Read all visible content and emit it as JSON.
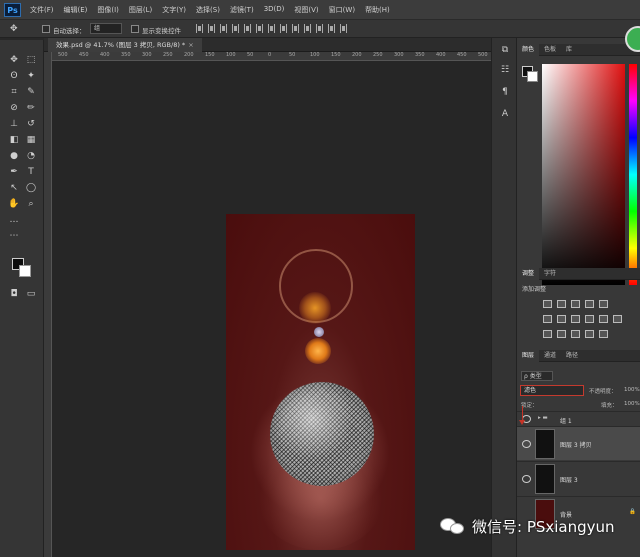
{
  "app": {
    "logo": "Ps"
  },
  "menu": [
    "文件(F)",
    "编辑(E)",
    "图像(I)",
    "图层(L)",
    "文字(Y)",
    "选择(S)",
    "滤镜(T)",
    "3D(D)",
    "视图(V)",
    "窗口(W)",
    "帮助(H)"
  ],
  "options": {
    "auto_select_label": "自动选择：",
    "auto_select_value": "组",
    "transform_label": "显示变换控件"
  },
  "document": {
    "tab_title": "效果.psd @ 41.7% (图层 3 拷贝, RGB/8) *",
    "ruler_ticks": [
      "500",
      "450",
      "400",
      "350",
      "300",
      "250",
      "200",
      "150",
      "100",
      "50",
      "0",
      "50",
      "100",
      "150",
      "200",
      "250",
      "300",
      "350",
      "400",
      "450",
      "500"
    ]
  },
  "color_panel": {
    "tabs": [
      "颜色",
      "色板",
      "库"
    ],
    "fg_color": "#111111",
    "bg_color": "#ffffff"
  },
  "adjust_panel": {
    "tabs": [
      "调整",
      "字符"
    ],
    "title": "添加调整"
  },
  "layers_panel": {
    "tabs": [
      "图层",
      "通道",
      "路径"
    ],
    "filter_kind": "ρ 类型",
    "blend_mode": "滤色",
    "opacity_label": "不透明度：",
    "opacity_value": "100%",
    "lock_label": "锁定：",
    "fill_label": "填充：",
    "fill_value": "100%",
    "layers": [
      {
        "name": "组 1",
        "type": "group"
      },
      {
        "name": "图层 3 拷贝",
        "type": "layer"
      },
      {
        "name": "图层 3",
        "type": "layer"
      },
      {
        "name": "背景",
        "type": "background"
      }
    ]
  },
  "watermark": {
    "text": "微信号: PSxiangyun"
  }
}
